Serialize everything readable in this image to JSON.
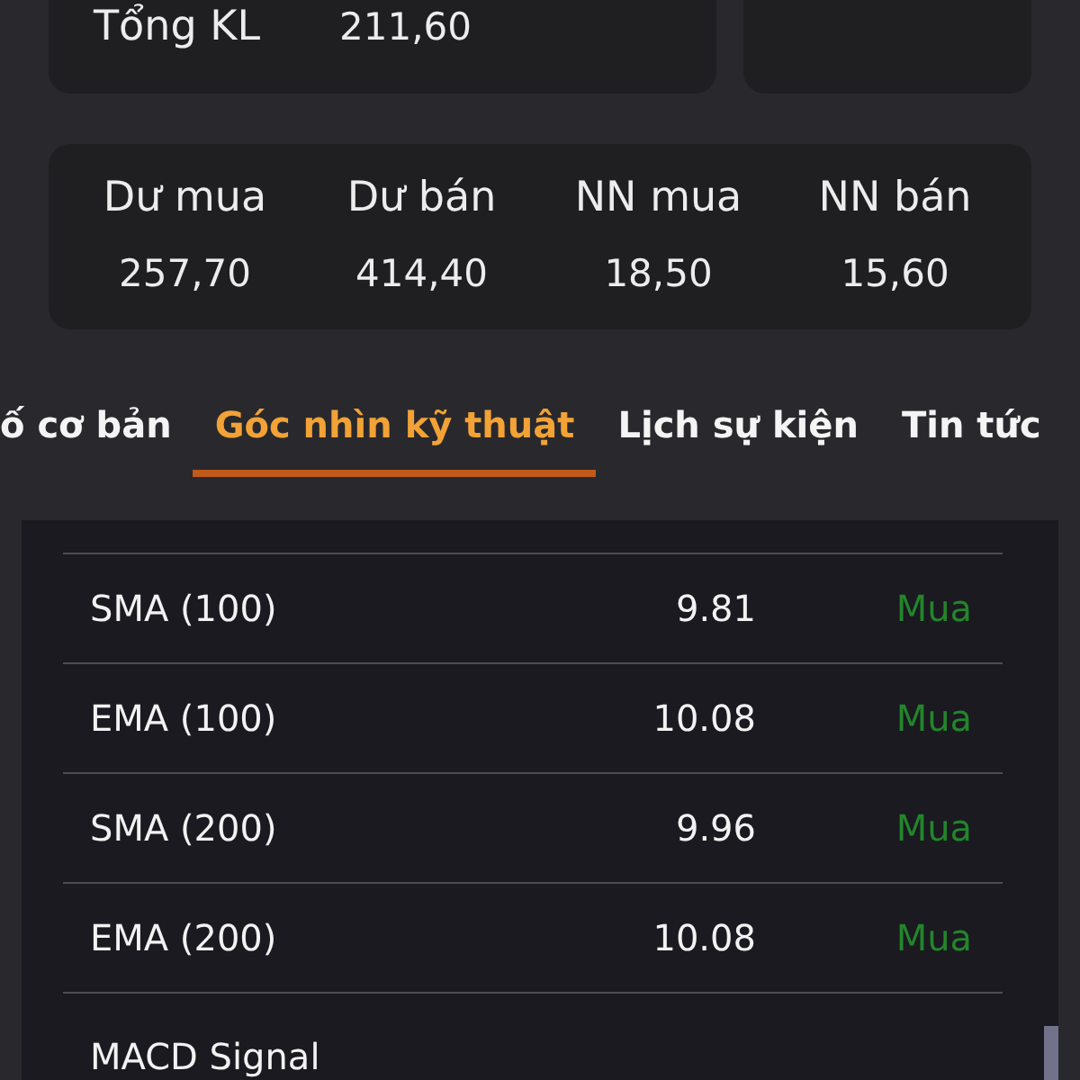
{
  "top_row": {
    "total_volume": {
      "label": "Tổng KL",
      "value": "211,60"
    }
  },
  "order_stats": [
    {
      "label": "Dư mua",
      "value": "257,70"
    },
    {
      "label": "Dư bán",
      "value": "414,40"
    },
    {
      "label": "NN mua",
      "value": "18,50"
    },
    {
      "label": "NN bán",
      "value": "15,60"
    }
  ],
  "tabs": [
    {
      "label": "ố cơ bản",
      "selected": false
    },
    {
      "label": "Góc nhìn kỹ thuật",
      "selected": true
    },
    {
      "label": "Lịch sự kiện",
      "selected": false
    },
    {
      "label": "Tin tức",
      "selected": false
    }
  ],
  "indicators": [
    {
      "name": "SMA (100)",
      "value": "9.81",
      "signal": "Mua"
    },
    {
      "name": "EMA (100)",
      "value": "10.08",
      "signal": "Mua"
    },
    {
      "name": "SMA (200)",
      "value": "9.96",
      "signal": "Mua"
    },
    {
      "name": "EMA (200)",
      "value": "10.08",
      "signal": "Mua"
    },
    {
      "name": "MACD Signal"
    }
  ]
}
